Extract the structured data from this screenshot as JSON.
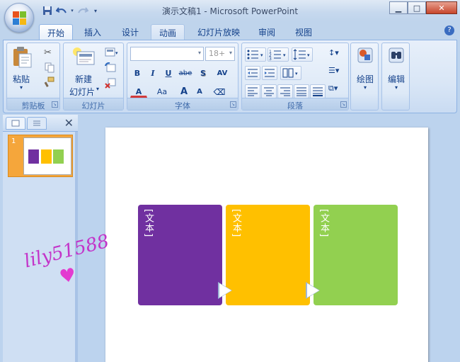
{
  "window": {
    "title": "演示文稿1 - Microsoft PowerPoint",
    "controls": [
      "minimize",
      "maximize",
      "close"
    ]
  },
  "qat": [
    "save-icon",
    "undo-icon",
    "redo-icon",
    "customize-icon"
  ],
  "tabs": [
    {
      "label": "开始",
      "active": true
    },
    {
      "label": "插入"
    },
    {
      "label": "设计"
    },
    {
      "label": "动画"
    },
    {
      "label": "幻灯片放映"
    },
    {
      "label": "审阅"
    },
    {
      "label": "视图"
    }
  ],
  "ribbon": {
    "clipboard": {
      "label": "剪贴板",
      "paste": "粘贴"
    },
    "slides": {
      "label": "幻灯片",
      "new_slide_1": "新建",
      "new_slide_2": "幻灯片"
    },
    "font": {
      "label": "字体",
      "font_name": "",
      "font_size": "18+",
      "buttons": [
        "B",
        "I",
        "U",
        "abe",
        "S",
        "AV",
        "A",
        "Aa",
        "A",
        "A"
      ]
    },
    "paragraph": {
      "label": "段落"
    },
    "drawing": {
      "label": "绘图"
    },
    "editing": {
      "label": "编辑"
    }
  },
  "slide_pane": {
    "slide_number": "1"
  },
  "slide": {
    "shapes": [
      {
        "text": "[文本]",
        "color": "#7030a0"
      },
      {
        "text": "[文本]",
        "color": "#ffc000"
      },
      {
        "text": "[文本]",
        "color": "#92d050"
      }
    ]
  },
  "watermark": "lily51588"
}
